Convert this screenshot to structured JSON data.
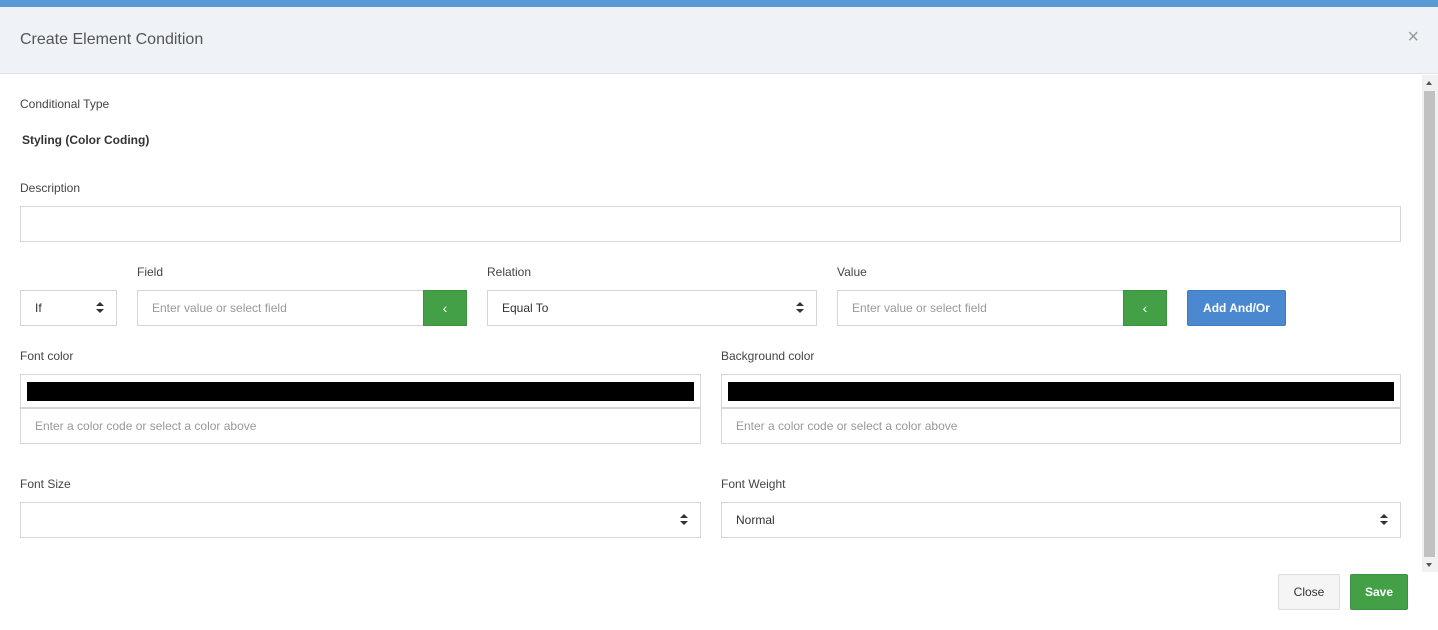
{
  "modal": {
    "title": "Create Element Condition",
    "close_symbol": "×"
  },
  "conditional_type": {
    "label": "Conditional Type",
    "value": "Styling (Color Coding)"
  },
  "description": {
    "label": "Description",
    "value": ""
  },
  "condition": {
    "operator_value": "If",
    "field_label": "Field",
    "field_placeholder": "Enter value or select field",
    "relation_label": "Relation",
    "relation_value": "Equal To",
    "value_label": "Value",
    "value_placeholder": "Enter value or select field",
    "pick_icon": "‹",
    "add_andor_label": "Add And/Or"
  },
  "font_color": {
    "label": "Font color",
    "swatch_color": "#000000",
    "placeholder": "Enter a color code or select a color above"
  },
  "background_color": {
    "label": "Background color",
    "swatch_color": "#000000",
    "placeholder": "Enter a color code or select a color above"
  },
  "font_size": {
    "label": "Font Size",
    "value": ""
  },
  "font_weight": {
    "label": "Font Weight",
    "value": "Normal"
  },
  "footer": {
    "close_label": "Close",
    "save_label": "Save"
  },
  "colors": {
    "accent_green": "#43a047",
    "accent_blue": "#4a89d0",
    "top_bar": "#5b9bd5"
  }
}
